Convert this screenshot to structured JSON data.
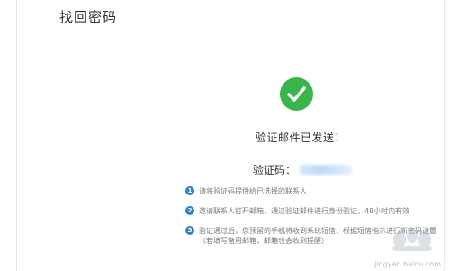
{
  "header": {
    "title": "找回密码"
  },
  "status": {
    "message": "验证邮件已发送！",
    "code_label": "验证码："
  },
  "tips": [
    {
      "num": "1",
      "text": "请将验证码提供给已选择的联系人"
    },
    {
      "num": "2",
      "text": "邀请联系人打开邮箱，通过验证邮件进行身份验证，48小时内有效"
    },
    {
      "num": "3",
      "text": "验证通过后，您预留的手机将收到系统短信，根据短信指示进行新密码设置",
      "text2": "（若填写备用邮箱，邮箱也会收到提醒）"
    }
  ],
  "watermark": {
    "url": "jingyan.baidu.com"
  },
  "colors": {
    "success": "#3ab54a",
    "tip_badge": "#2e7fd6"
  }
}
